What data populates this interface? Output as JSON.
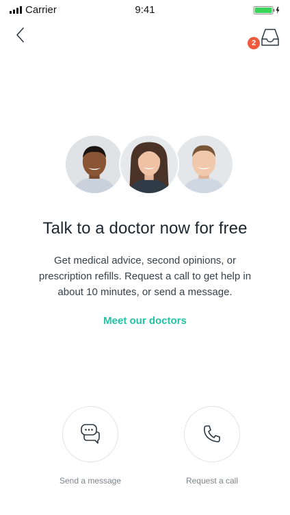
{
  "status_bar": {
    "carrier": "Carrier",
    "time": "9:41",
    "signal_icon": "signal-bars-icon",
    "battery_icon": "battery-charging-icon",
    "battery_color": "#3ad45a"
  },
  "nav": {
    "back_icon": "chevron-left-icon",
    "inbox_icon": "inbox-tray-icon",
    "inbox_badge_count": "2",
    "badge_color": "#ef5a3c"
  },
  "doctors": {
    "avatars": [
      "doctor-avatar-1",
      "doctor-avatar-2",
      "doctor-avatar-3"
    ]
  },
  "main": {
    "headline": "Talk to a doctor now for free",
    "description": "Get medical advice, second opinions, or prescription refills. Request a call to get help in about 10 minutes, or send a message.",
    "meet_link": "Meet our doctors",
    "accent_color": "#1fc3a6"
  },
  "actions": {
    "message": {
      "label": "Send a message",
      "icon": "chat-bubbles-icon"
    },
    "call": {
      "label": "Request a call",
      "icon": "phone-icon"
    }
  }
}
